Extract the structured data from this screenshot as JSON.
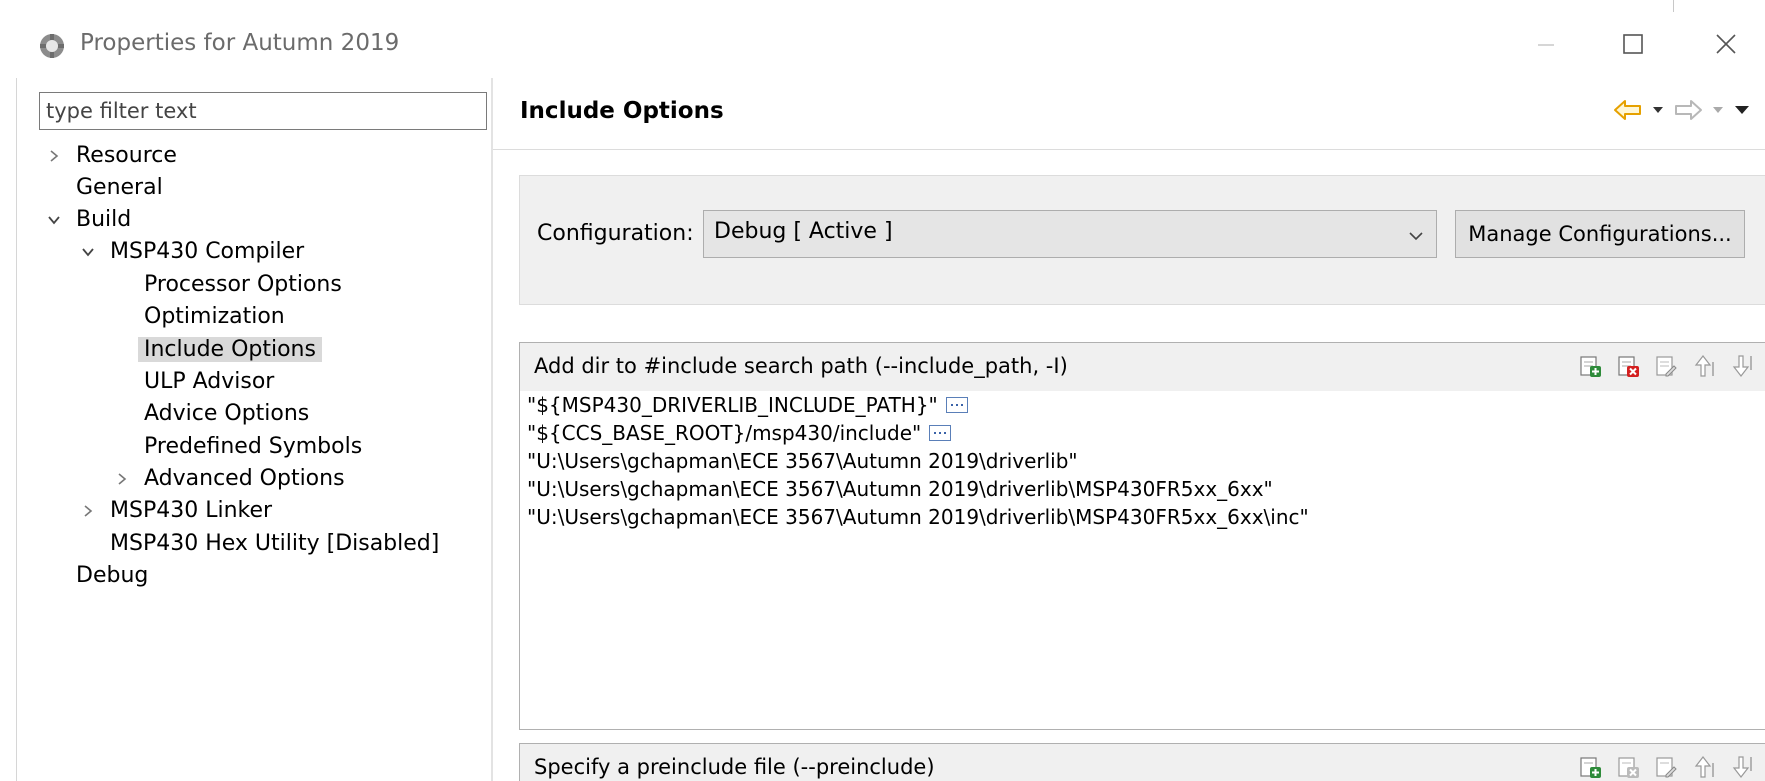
{
  "window": {
    "title": "Properties for Autumn 2019"
  },
  "left": {
    "filter_placeholder": "type filter text",
    "tree": [
      {
        "label": "Resource",
        "twisty": "collapsed",
        "selected": false
      },
      {
        "label": "General",
        "twisty": "none",
        "selected": false
      },
      {
        "label": "Build",
        "twisty": "expanded",
        "selected": false
      },
      {
        "label": "MSP430 Compiler",
        "twisty": "expanded",
        "selected": false
      },
      {
        "label": "Processor Options",
        "twisty": "none",
        "selected": false
      },
      {
        "label": "Optimization",
        "twisty": "none",
        "selected": false
      },
      {
        "label": "Include Options",
        "twisty": "none",
        "selected": true
      },
      {
        "label": "ULP Advisor",
        "twisty": "none",
        "selected": false
      },
      {
        "label": "Advice Options",
        "twisty": "none",
        "selected": false
      },
      {
        "label": "Predefined Symbols",
        "twisty": "none",
        "selected": false
      },
      {
        "label": "Advanced Options",
        "twisty": "collapsed",
        "selected": false
      },
      {
        "label": "MSP430 Linker",
        "twisty": "collapsed",
        "selected": false
      },
      {
        "label": "MSP430 Hex Utility  [Disabled]",
        "twisty": "none",
        "selected": false
      },
      {
        "label": "Debug",
        "twisty": "none",
        "selected": false
      }
    ]
  },
  "page": {
    "title": "Include Options",
    "nav_icons": [
      "back-arrow-icon",
      "back-dropdown-icon",
      "forward-arrow-icon",
      "forward-dropdown-icon",
      "view-menu-icon"
    ]
  },
  "config": {
    "label": "Configuration:",
    "selected": "Debug  [ Active ]",
    "manage_label": "Manage Configurations..."
  },
  "include_group": {
    "title": "Add dir to #include search path (--include_path, -I)",
    "tools": [
      "add-path-icon",
      "delete-path-icon",
      "edit-path-icon",
      "move-up-icon",
      "move-down-icon"
    ],
    "paths": [
      {
        "text": "\"${MSP430_DRIVERLIB_INCLUDE_PATH}\"",
        "has_variable_icon": true
      },
      {
        "text": "\"${CCS_BASE_ROOT}/msp430/include\"",
        "has_variable_icon": true
      },
      {
        "text": "\"U:\\Users\\gchapman\\ECE 3567\\Autumn 2019\\driverlib\"",
        "has_variable_icon": false
      },
      {
        "text": "\"U:\\Users\\gchapman\\ECE 3567\\Autumn 2019\\driverlib\\MSP430FR5xx_6xx\"",
        "has_variable_icon": false
      },
      {
        "text": "\"U:\\Users\\gchapman\\ECE 3567\\Autumn 2019\\driverlib\\MSP430FR5xx_6xx\\inc\"",
        "has_variable_icon": false
      }
    ]
  },
  "preinclude_group": {
    "title": "Specify a preinclude file (--preinclude)",
    "tools": [
      "add-file-icon",
      "delete-file-icon",
      "edit-file-icon",
      "move-up-icon",
      "move-down-icon"
    ]
  },
  "colors": {
    "selection": "#d9d9d9",
    "group_background": "#f0f0f0",
    "nav_back": "#f2a000",
    "add_green": "#2e8b3a",
    "delete_red": "#d42020"
  }
}
